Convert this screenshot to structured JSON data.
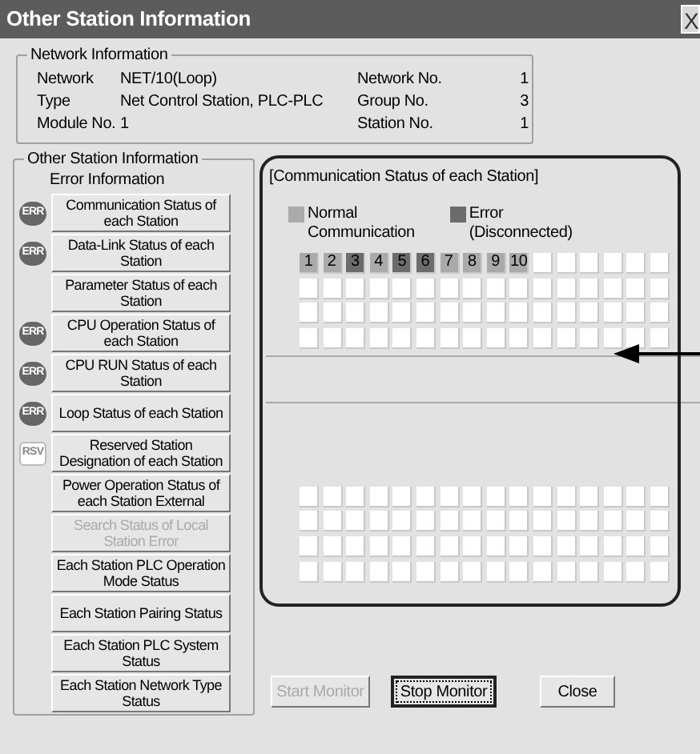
{
  "window": {
    "title": "Other Station Information",
    "close": "X"
  },
  "network_information": {
    "title": "Network Information",
    "fields": [
      {
        "label": "Network",
        "value": "NET/10(Loop)"
      },
      {
        "label": "Network No.",
        "value": "1"
      },
      {
        "label": "Type",
        "value": "Net Control Station, PLC-PLC"
      },
      {
        "label": "Group No.",
        "value": "3"
      },
      {
        "label": "Module No.",
        "value": "1"
      },
      {
        "label": "Station No.",
        "value": "1"
      }
    ]
  },
  "other_station_information": {
    "title": "Other Station Information",
    "subtitle": "Error Information",
    "buttons": [
      {
        "label": "Communication Status of each Station",
        "badge": "ERR",
        "disabled": false
      },
      {
        "label": "Data-Link Status of each Station",
        "badge": "ERR",
        "disabled": false
      },
      {
        "label": "Parameter Status of each Station",
        "disabled": false
      },
      {
        "label": "CPU Operation Status of each Station",
        "badge": "ERR",
        "disabled": false
      },
      {
        "label": "CPU RUN Status of each Station",
        "badge": "ERR",
        "disabled": false
      },
      {
        "label": "Loop Status of each Station",
        "badge": "ERR",
        "disabled": false
      },
      {
        "label": "Reserved Station Designation of each Station",
        "badge": "RSV",
        "disabled": false
      },
      {
        "label": "Power Operation Status of each Station External",
        "disabled": false
      },
      {
        "label": "Search Status of Local Station Error",
        "disabled": true
      },
      {
        "label": "Each Station PLC Operation Mode Status",
        "disabled": false
      },
      {
        "label": "Each Station Pairing Status",
        "disabled": false
      },
      {
        "label": "Each Station PLC System Status",
        "disabled": false
      },
      {
        "label": "Each Station Network Type Status",
        "disabled": false
      }
    ]
  },
  "status_panel": {
    "title": "[Communication Status of each Station]",
    "legend": [
      {
        "label": "Normal Communication",
        "kind": "normal"
      },
      {
        "label": "Error (Disconnected)",
        "kind": "error"
      }
    ],
    "stations": [
      {
        "label": "1",
        "kind": "normal"
      },
      {
        "label": "2",
        "kind": "normal"
      },
      {
        "label": "3",
        "kind": "error"
      },
      {
        "label": "4",
        "kind": "normal"
      },
      {
        "label": "5",
        "kind": "error"
      },
      {
        "label": "6",
        "kind": "error"
      },
      {
        "label": "7",
        "kind": "normal"
      },
      {
        "label": "8",
        "kind": "normal"
      },
      {
        "label": "9",
        "kind": "normal"
      },
      {
        "label": "10",
        "kind": "normal"
      }
    ]
  },
  "footer_buttons": [
    {
      "label": "Start Monitor",
      "disabled": true,
      "focused": false
    },
    {
      "label": "Stop Monitor",
      "disabled": false,
      "focused": true
    },
    {
      "label": "Close",
      "disabled": false,
      "focused": false
    }
  ]
}
